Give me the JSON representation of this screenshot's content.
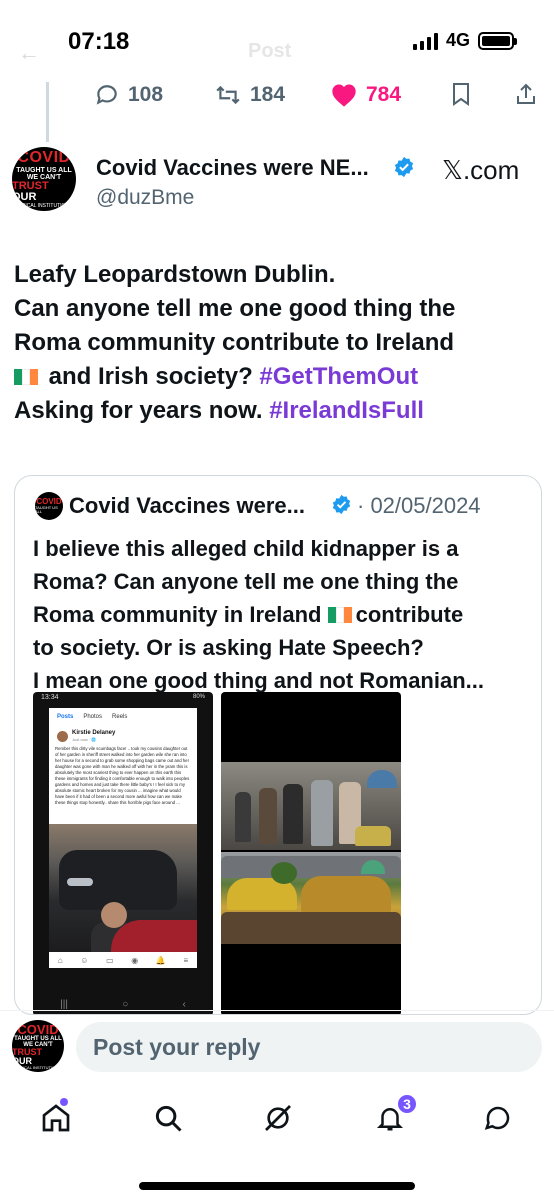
{
  "status_bar": {
    "time": "07:18",
    "network": "4G"
  },
  "header": {
    "title_ghost": "Post"
  },
  "engagement": {
    "replies": "108",
    "reposts": "184",
    "likes": "784"
  },
  "author": {
    "name": "Covid Vaccines were NE...",
    "handle": "@duzBme",
    "source_label": "𝕏.com",
    "avatar_text": [
      "COVID",
      "TAUGHT US ALL",
      "WE CAN'T",
      "TRUST",
      "OUR",
      "MEDICAL INSTITUTIONS."
    ]
  },
  "tweet": {
    "lines": [
      "Leafy Leopardstown Dublin.",
      "Can anyone tell me one good thing the",
      "Roma community contribute to Ireland",
      " and Irish society? ",
      "Asking for years now. "
    ],
    "hashtags": [
      "#GetThemOut",
      "#IrelandIsFull"
    ]
  },
  "quoted": {
    "name": "Covid Vaccines were...",
    "date": "· 02/05/2024",
    "lines": [
      "I believe this alleged child kidnapper is a",
      "Roma? Can anyone tell me one thing the",
      "Roma community in Ireland",
      "contribute",
      "to society. Or is asking Hate Speech?",
      "I mean one good thing and not Romanian..."
    ],
    "screenshot": {
      "status_time": "13:34",
      "status_right": "80%",
      "tabs": [
        "Posts",
        "Photos",
        "Reels"
      ],
      "user": "Kirstie Delaney",
      "sub": "Just now · 🌐",
      "body": "Rember this dirty vile scumbags face! .. took my cousins daughter out of her garden in sheriff street walked into her garden wile she ran into her house for a second to grab some shopping bags came out and her daughter was gone with man he walked off with her in the pram this is absolutely the most scariest thing to ever happen on this earth this these immigrants for finding it comfortable enough to walk into peoples gardens and homes and just take there little baby's ! I feel sick to my absolute stomic heart broken for my cousin ... imagine what would have been if it had of been a second more awful how can we make these things stop honestly.. share this horrible pigs face around ..."
    }
  },
  "reply": {
    "placeholder": "Post your reply"
  },
  "bottom_nav": {
    "items": [
      "home",
      "search",
      "grok",
      "notifications",
      "messages"
    ],
    "notification_badge": "3"
  },
  "colors": {
    "hashtag": "#7a3ad6",
    "like": "#f91880",
    "accent": "#7856ff",
    "muted": "#536471",
    "verified": "#1d9bf0"
  }
}
